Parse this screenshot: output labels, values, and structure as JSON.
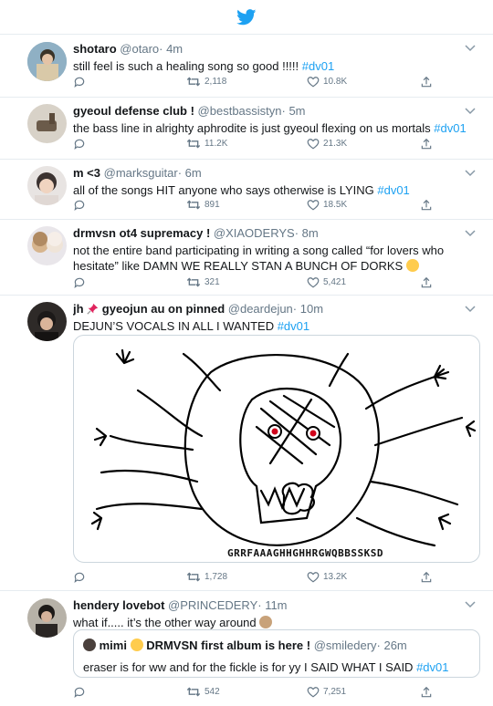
{
  "app": {
    "logo_color": "#1da1f2",
    "logo_icon": "twitter-bird-icon"
  },
  "tweets": [
    {
      "name": "shotaro",
      "handle": "@otaro",
      "time": "· 4m",
      "text": "still feel is such a healing song so good !!!!! ",
      "hashtag": "#dv01",
      "replies": "",
      "retweets": "2,118",
      "likes": "10.8K"
    },
    {
      "name": "gyeoul defense club !",
      "handle": "@bestbassistyn",
      "time": "· 5m",
      "text": "the bass line in alrighty aphrodite is just gyeoul flexing on us mortals ",
      "hashtag": "#dv01",
      "replies": "",
      "retweets": "11.2K",
      "likes": "21.3K"
    },
    {
      "name": "m <3",
      "handle": "@marksguitar",
      "time": "· 6m",
      "text": "all of the songs HIT anyone who says otherwise is LYING ",
      "hashtag": "#dv01",
      "replies": "",
      "retweets": "891",
      "likes": "18.5K"
    },
    {
      "name": "drmvsn ot4 supremacy !",
      "handle": "@XIAODERYS",
      "time": "· 8m",
      "text": "not the entire band participating in writing a song called “for lovers who hesitate” like DAMN WE REALLY STAN A BUNCH OF DORKS",
      "emoji": "crying-face-emoji",
      "replies": "",
      "retweets": "321",
      "likes": "5,421"
    },
    {
      "name": "jh",
      "name_rest": " gyeojun au on pinned",
      "pin_emoji": "pushpin-emoji",
      "handle": "@deardejun",
      "time": "· 10m",
      "text": "DEJUN’S VOCALS IN ALL I WANTED ",
      "hashtag": "#dv01",
      "image_caption": "GRRFAAAGHHGHHRGWQBBSSKSD",
      "replies": "",
      "retweets": "1,728",
      "likes": "13.2K"
    },
    {
      "name": "hendery lovebot",
      "handle": "@PRINCEDERY",
      "time": "· 11m",
      "text": "what if..... it’s the other way around",
      "emoji": "monkey-face-emoji",
      "quote": {
        "name": "mimi",
        "name_emoji": "heart-hands-emoji",
        "name_rest": " DRMVSN first album is here !",
        "handle": "@smiledery",
        "time": "· 26m",
        "text": "eraser is for ww and for the fickle is for yy I SAID WHAT I SAID ",
        "hashtag": "#dv01"
      },
      "replies": "",
      "retweets": "542",
      "likes": "7,251"
    }
  ]
}
